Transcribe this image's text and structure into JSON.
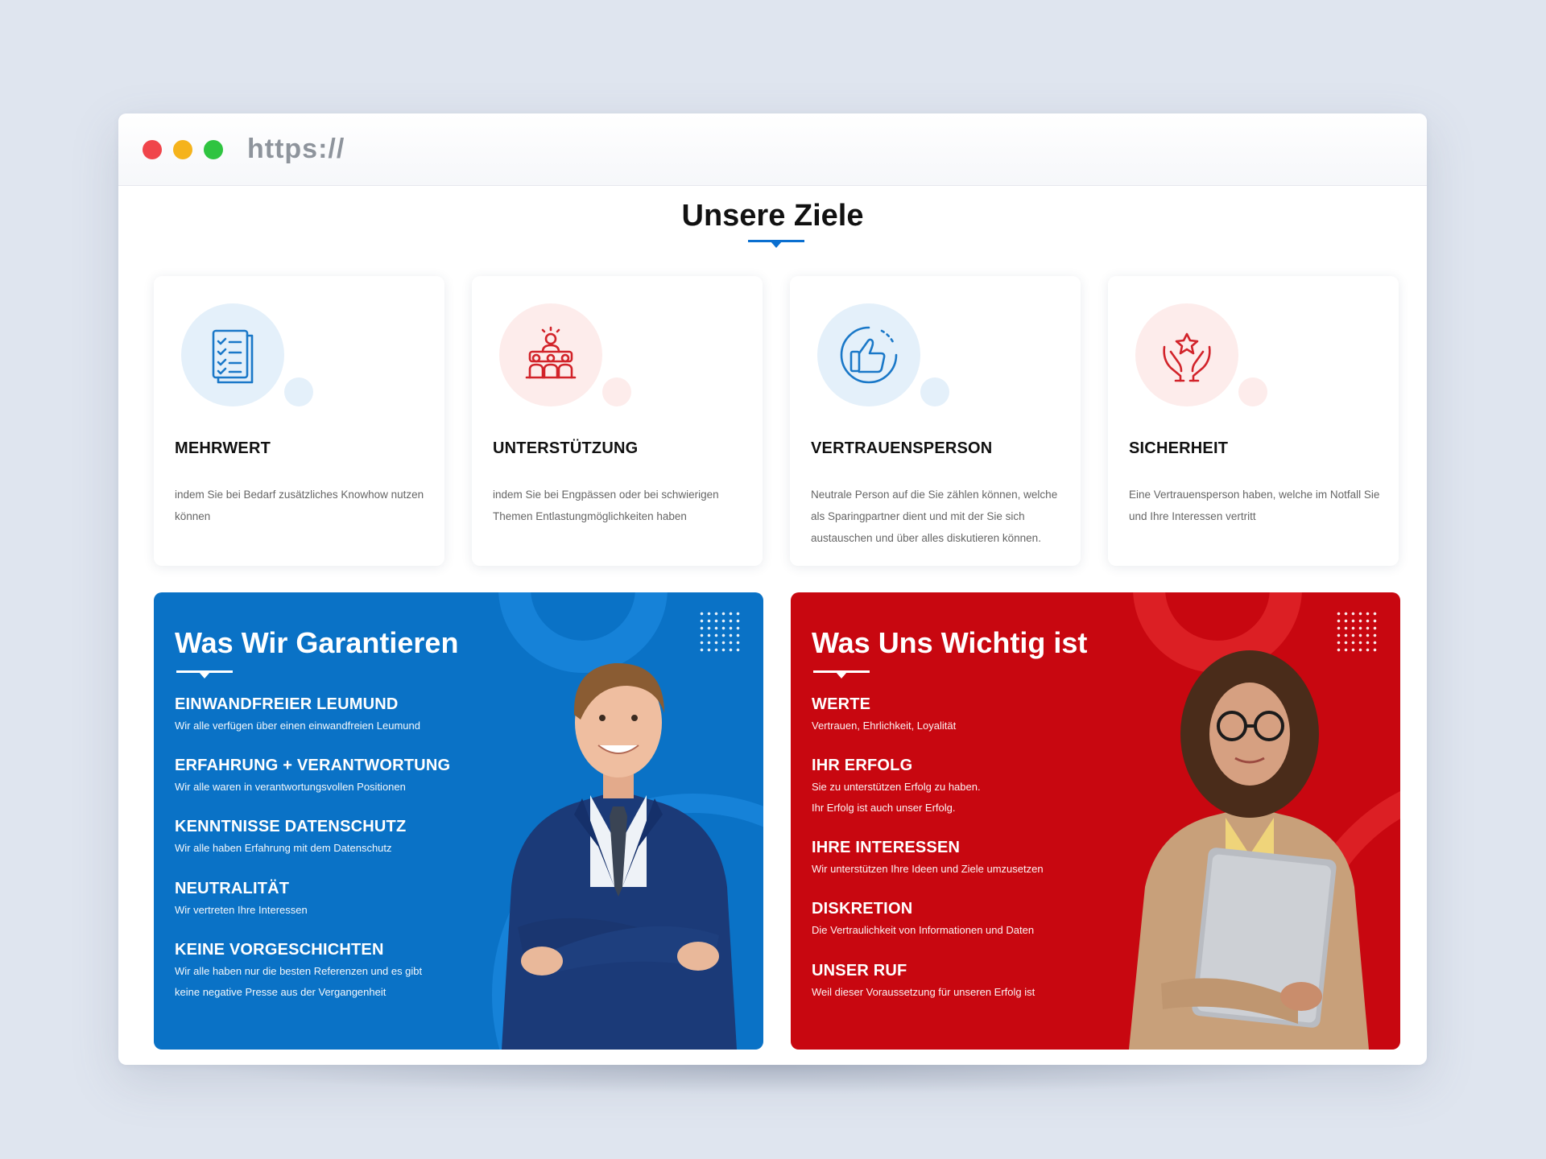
{
  "browser": {
    "url": "https://"
  },
  "section": {
    "title": "Unsere Ziele"
  },
  "cards": [
    {
      "icon": "checklist-icon",
      "title": "MEHRWERT",
      "text": "indem Sie bei Bedarf zusätzliches Knowhow nutzen können"
    },
    {
      "icon": "team-idea-icon",
      "title": "UNTERSTÜTZUNG",
      "text": "indem Sie bei Engpässen oder bei schwierigen Themen Entlastungmöglichkeiten haben"
    },
    {
      "icon": "thumbs-up-icon",
      "title": "VERTRAUENSPERSON",
      "text": "Neutrale Person auf die Sie zählen können, welche als Sparingpartner dient und mit der Sie sich austauschen und über alles diskutieren können."
    },
    {
      "icon": "hands-star-icon",
      "title": "SICHERHEIT",
      "text": "Eine Vertrauensperson haben, welche im Notfall Sie und Ihre Interessen vertritt"
    }
  ],
  "guarantee": {
    "title": "Was Wir Garantieren",
    "items": [
      {
        "title": "EINWANDFREIER LEUMUND",
        "text": "Wir alle verfügen über einen einwandfreien Leumund"
      },
      {
        "title": "ERFAHRUNG + VERANTWORTUNG",
        "text": "Wir alle waren in verantwortungsvollen Positionen"
      },
      {
        "title": "KENNTNISSE DATENSCHUTZ",
        "text": "Wir alle haben Erfahrung mit dem Datenschutz"
      },
      {
        "title": "NEUTRALITÄT",
        "text": "Wir vertreten Ihre Interessen"
      },
      {
        "title": "KEINE VORGESCHICHTEN",
        "text": "Wir alle haben nur die besten Referenzen und es gibt\n keine negative Presse aus der Vergangenheit"
      }
    ]
  },
  "important": {
    "title": "Was Uns Wichtig ist",
    "items": [
      {
        "title": "WERTE",
        "text": "Vertrauen, Ehrlichkeit, Loyalität"
      },
      {
        "title": "IHR ERFOLG",
        "text": "Sie zu unterstützen Erfolg zu haben.\nIhr Erfolg ist auch unser Erfolg."
      },
      {
        "title": "IHRE INTERESSEN",
        "text": "Wir unterstützen Ihre Ideen und Ziele umzusetzen"
      },
      {
        "title": "DISKRETION",
        "text": "Die Vertraulichkeit von Informationen und Daten"
      },
      {
        "title": "UNSER RUF",
        "text": "Weil dieser Voraussetzung für unseren Erfolg ist"
      }
    ]
  },
  "colors": {
    "accent_blue": "#0a72c6",
    "accent_red": "#c80710",
    "icon_blue": "#1a78c8",
    "icon_red": "#d2232a"
  }
}
